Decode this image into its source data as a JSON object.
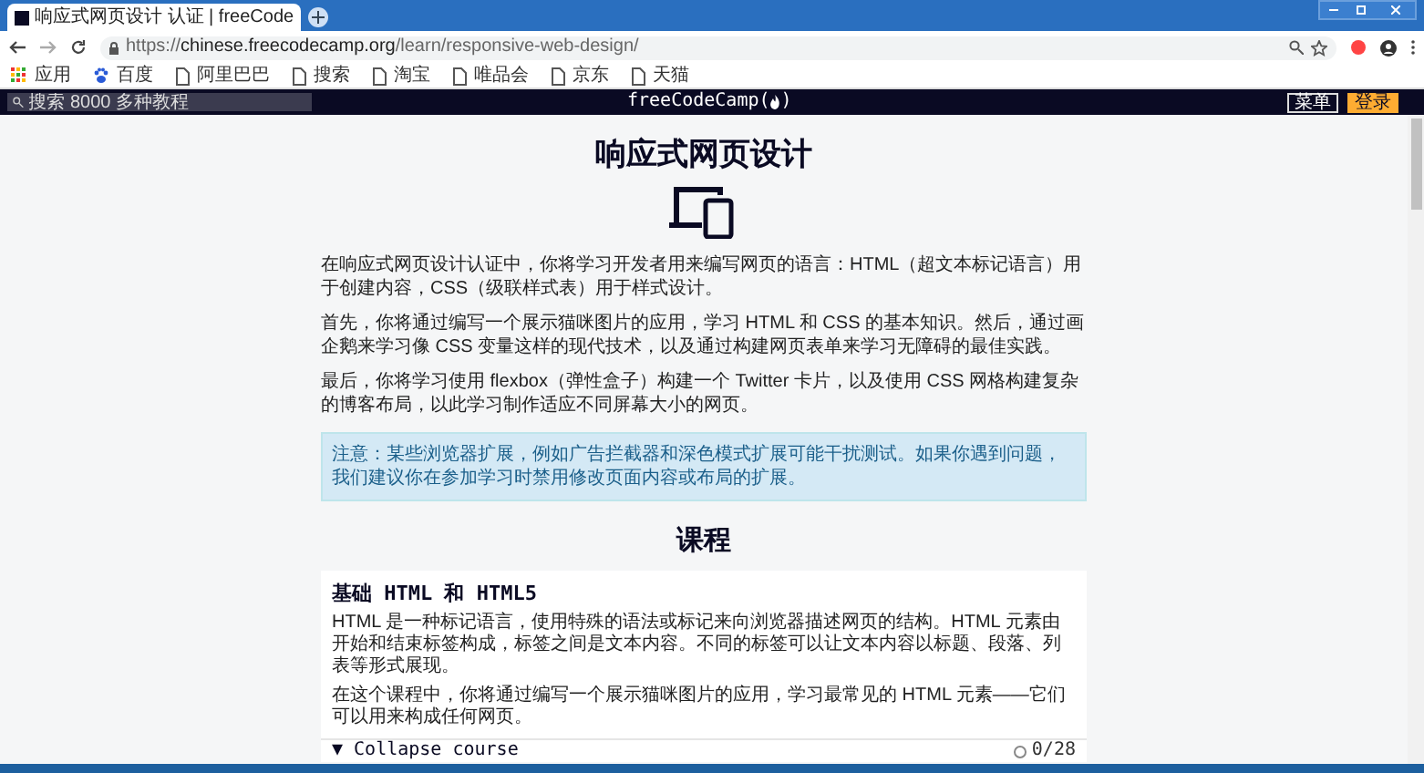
{
  "browser": {
    "tab_title": "响应式网页设计 认证 | freeCode",
    "url": {
      "scheme": "https://",
      "domain": "chinese.freecodecamp.org",
      "path": "/learn/responsive-web-design/"
    },
    "bookmarks": [
      {
        "label": "应用",
        "kind": "apps"
      },
      {
        "label": "百度",
        "kind": "paw"
      },
      {
        "label": "阿里巴巴",
        "kind": "page"
      },
      {
        "label": "搜索",
        "kind": "page"
      },
      {
        "label": "淘宝",
        "kind": "page"
      },
      {
        "label": "唯品会",
        "kind": "page"
      },
      {
        "label": "京东",
        "kind": "page"
      },
      {
        "label": "天猫",
        "kind": "page"
      }
    ]
  },
  "nav": {
    "search": {
      "placeholder": "搜索 8000 多种教程"
    },
    "logo": "freeCodeCamp(",
    "logo_end": ")",
    "buttons": [
      {
        "label": "菜单",
        "kind": "outline"
      },
      {
        "label": "登录",
        "kind": "primary"
      }
    ]
  },
  "intro": {
    "title": "响应式网页设计",
    "paragraphs": [
      "在响应式网页设计认证中，你将学习开发者用来编写网页的语言：HTML（超文本标记语言）用于创建内容，CSS（级联样式表）用于样式设计。",
      "首先，你将通过编写一个展示猫咪图片的应用，学习 HTML 和 CSS 的基本知识。然后，通过画企鹅来学习像 CSS 变量这样的现代技术，以及通过构建网页表单来学习无障碍的最佳实践。",
      "最后，你将学习使用 flexbox（弹性盒子）构建一个 Twitter 卡片，以及使用 CSS 网格构建复杂的博客布局，以此学习制作适应不同屏幕大小的网页。"
    ],
    "notice": "注意：某些浏览器扩展，例如广告拦截器和深色模式扩展可能干扰测试。如果你遇到问题，我们建议你在参加学习时禁用修改页面内容或布局的扩展。"
  },
  "courses": {
    "heading": "课程",
    "items": [
      {
        "title": "基础 HTML 和 HTML5",
        "paragraphs": [
          "HTML 是一种标记语言，使用特殊的语法或标记来向浏览器描述网页的结构。HTML 元素由开始和结束标签构成，标签之间是文本内容。不同的标签可以让文本内容以标题、段落、列表等形式展现。",
          "在这个课程中，你将通过编写一个展示猫咪图片的应用，学习最常见的 HTML 元素——它们可以用来构成任何网页。"
        ],
        "toggle": "▼ Collapse course",
        "expanded": true,
        "progress": "0/28"
      }
    ]
  }
}
